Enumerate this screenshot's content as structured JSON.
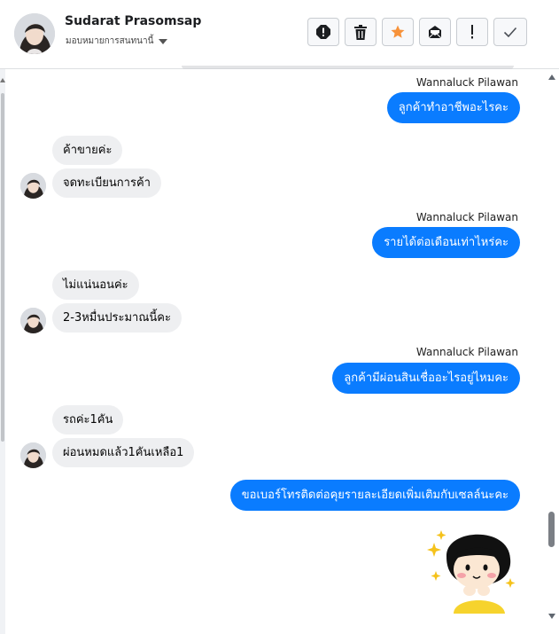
{
  "header": {
    "name": "Sudarat Prasomsap",
    "subtitle": "มอบหมายการสนทนานี้",
    "actions": [
      {
        "icon": "alert-circle-icon"
      },
      {
        "icon": "trash-icon"
      },
      {
        "icon": "star-icon"
      },
      {
        "icon": "mark-unread-icon"
      },
      {
        "icon": "exclamation-icon"
      },
      {
        "icon": "checkmark-icon"
      }
    ]
  },
  "conversation": {
    "sender_label": "Wannaluck Pilawan",
    "messages": [
      {
        "from": "page",
        "text": "ลูกค้าทำอาชีพอะไรคะ"
      },
      {
        "from": "customer",
        "text": "ค้าขายค่ะ"
      },
      {
        "from": "customer",
        "text": "จดทะเบียนการค้า"
      },
      {
        "from": "page",
        "text": "รายได้ต่อเดือนเท่าไหร่คะ"
      },
      {
        "from": "customer",
        "text": "ไม่แน่นอนค่ะ"
      },
      {
        "from": "customer",
        "text": "2-3หมื่นประมาณนี้คะ"
      },
      {
        "from": "page",
        "text": "ลูกค้ามีผ่อนสินเชื่ออะไรอยู่ไหมคะ"
      },
      {
        "from": "customer",
        "text": "รถค่ะ1คัน"
      },
      {
        "from": "customer",
        "text": "ผ่อนหมดแล้ว1คันเหลือ1"
      },
      {
        "from": "page",
        "text": "ขอเบอร์โทรติดต่อคุยรายละเอียดเพิ่มเติมกับเซลล์นะคะ"
      },
      {
        "from": "page",
        "sticker": "cartoon-girl-sticker"
      }
    ]
  },
  "colors": {
    "outgoing_bubble": "#0a7cff",
    "incoming_bubble": "#eeeff1",
    "star_active": "#f7923a"
  }
}
